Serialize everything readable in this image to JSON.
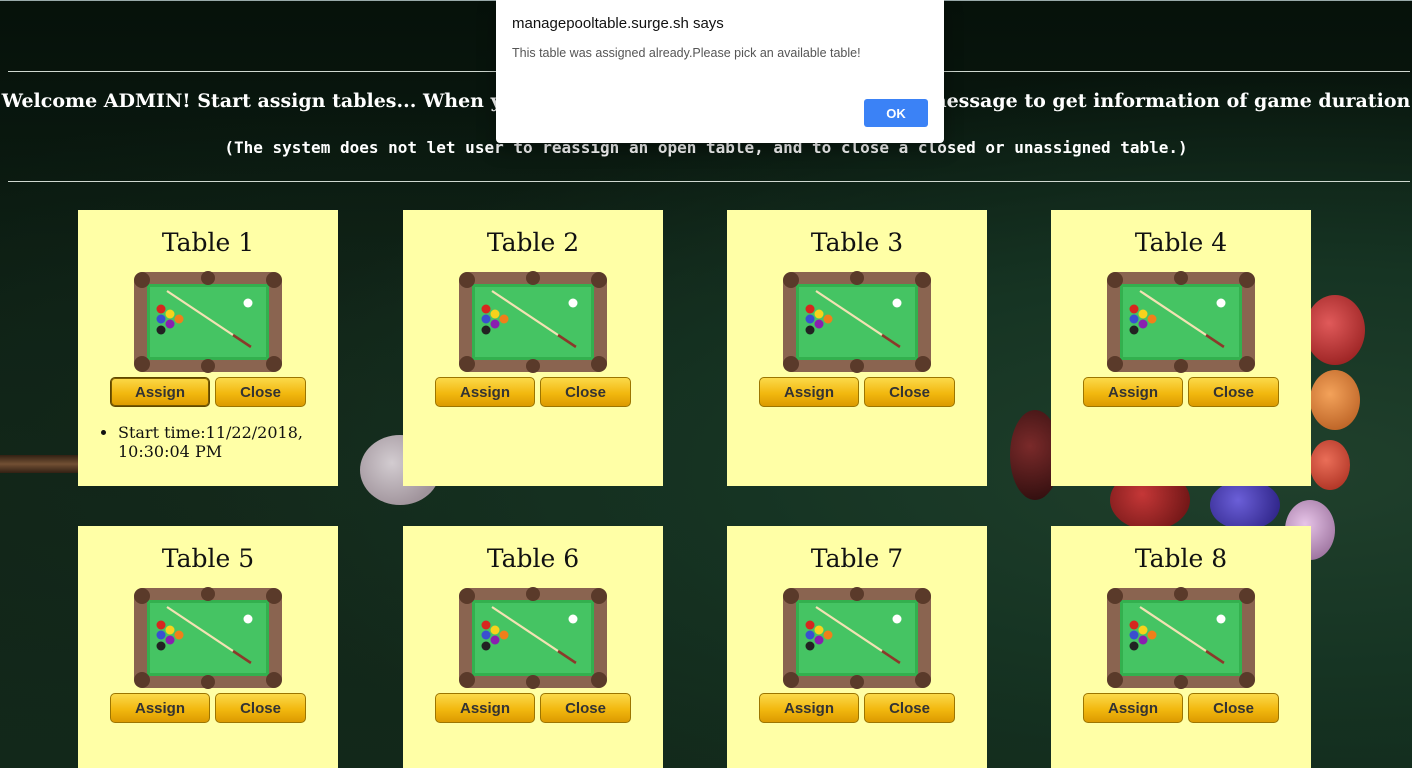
{
  "welcome_text": "Welcome ADMIN! Start assign tables... When you close a table, the system will show a message to get information of game duration and cost.",
  "note_text": "(The system does not let user to reassign an open table, and to close a closed or unassigned table.)",
  "tables": [
    {
      "title": "Table 1",
      "assign_label": "Assign",
      "close_label": "Close",
      "info": "Start time:11/22/2018, 10:30:04 PM"
    },
    {
      "title": "Table 2",
      "assign_label": "Assign",
      "close_label": "Close"
    },
    {
      "title": "Table 3",
      "assign_label": "Assign",
      "close_label": "Close"
    },
    {
      "title": "Table 4",
      "assign_label": "Assign",
      "close_label": "Close"
    },
    {
      "title": "Table 5",
      "assign_label": "Assign",
      "close_label": "Close"
    },
    {
      "title": "Table 6",
      "assign_label": "Assign",
      "close_label": "Close"
    },
    {
      "title": "Table 7",
      "assign_label": "Assign",
      "close_label": "Close"
    },
    {
      "title": "Table 8",
      "assign_label": "Assign",
      "close_label": "Close"
    }
  ],
  "dialog": {
    "title": "managepooltable.surge.sh says",
    "message": "This table was assigned already.Please pick an available table!",
    "ok_label": "OK"
  },
  "colors": {
    "card_background": "#ffffa6",
    "button_gold": "#f2b80f",
    "felt_green": "#3dbf5c",
    "dialog_ok_blue": "#3b82f6"
  }
}
